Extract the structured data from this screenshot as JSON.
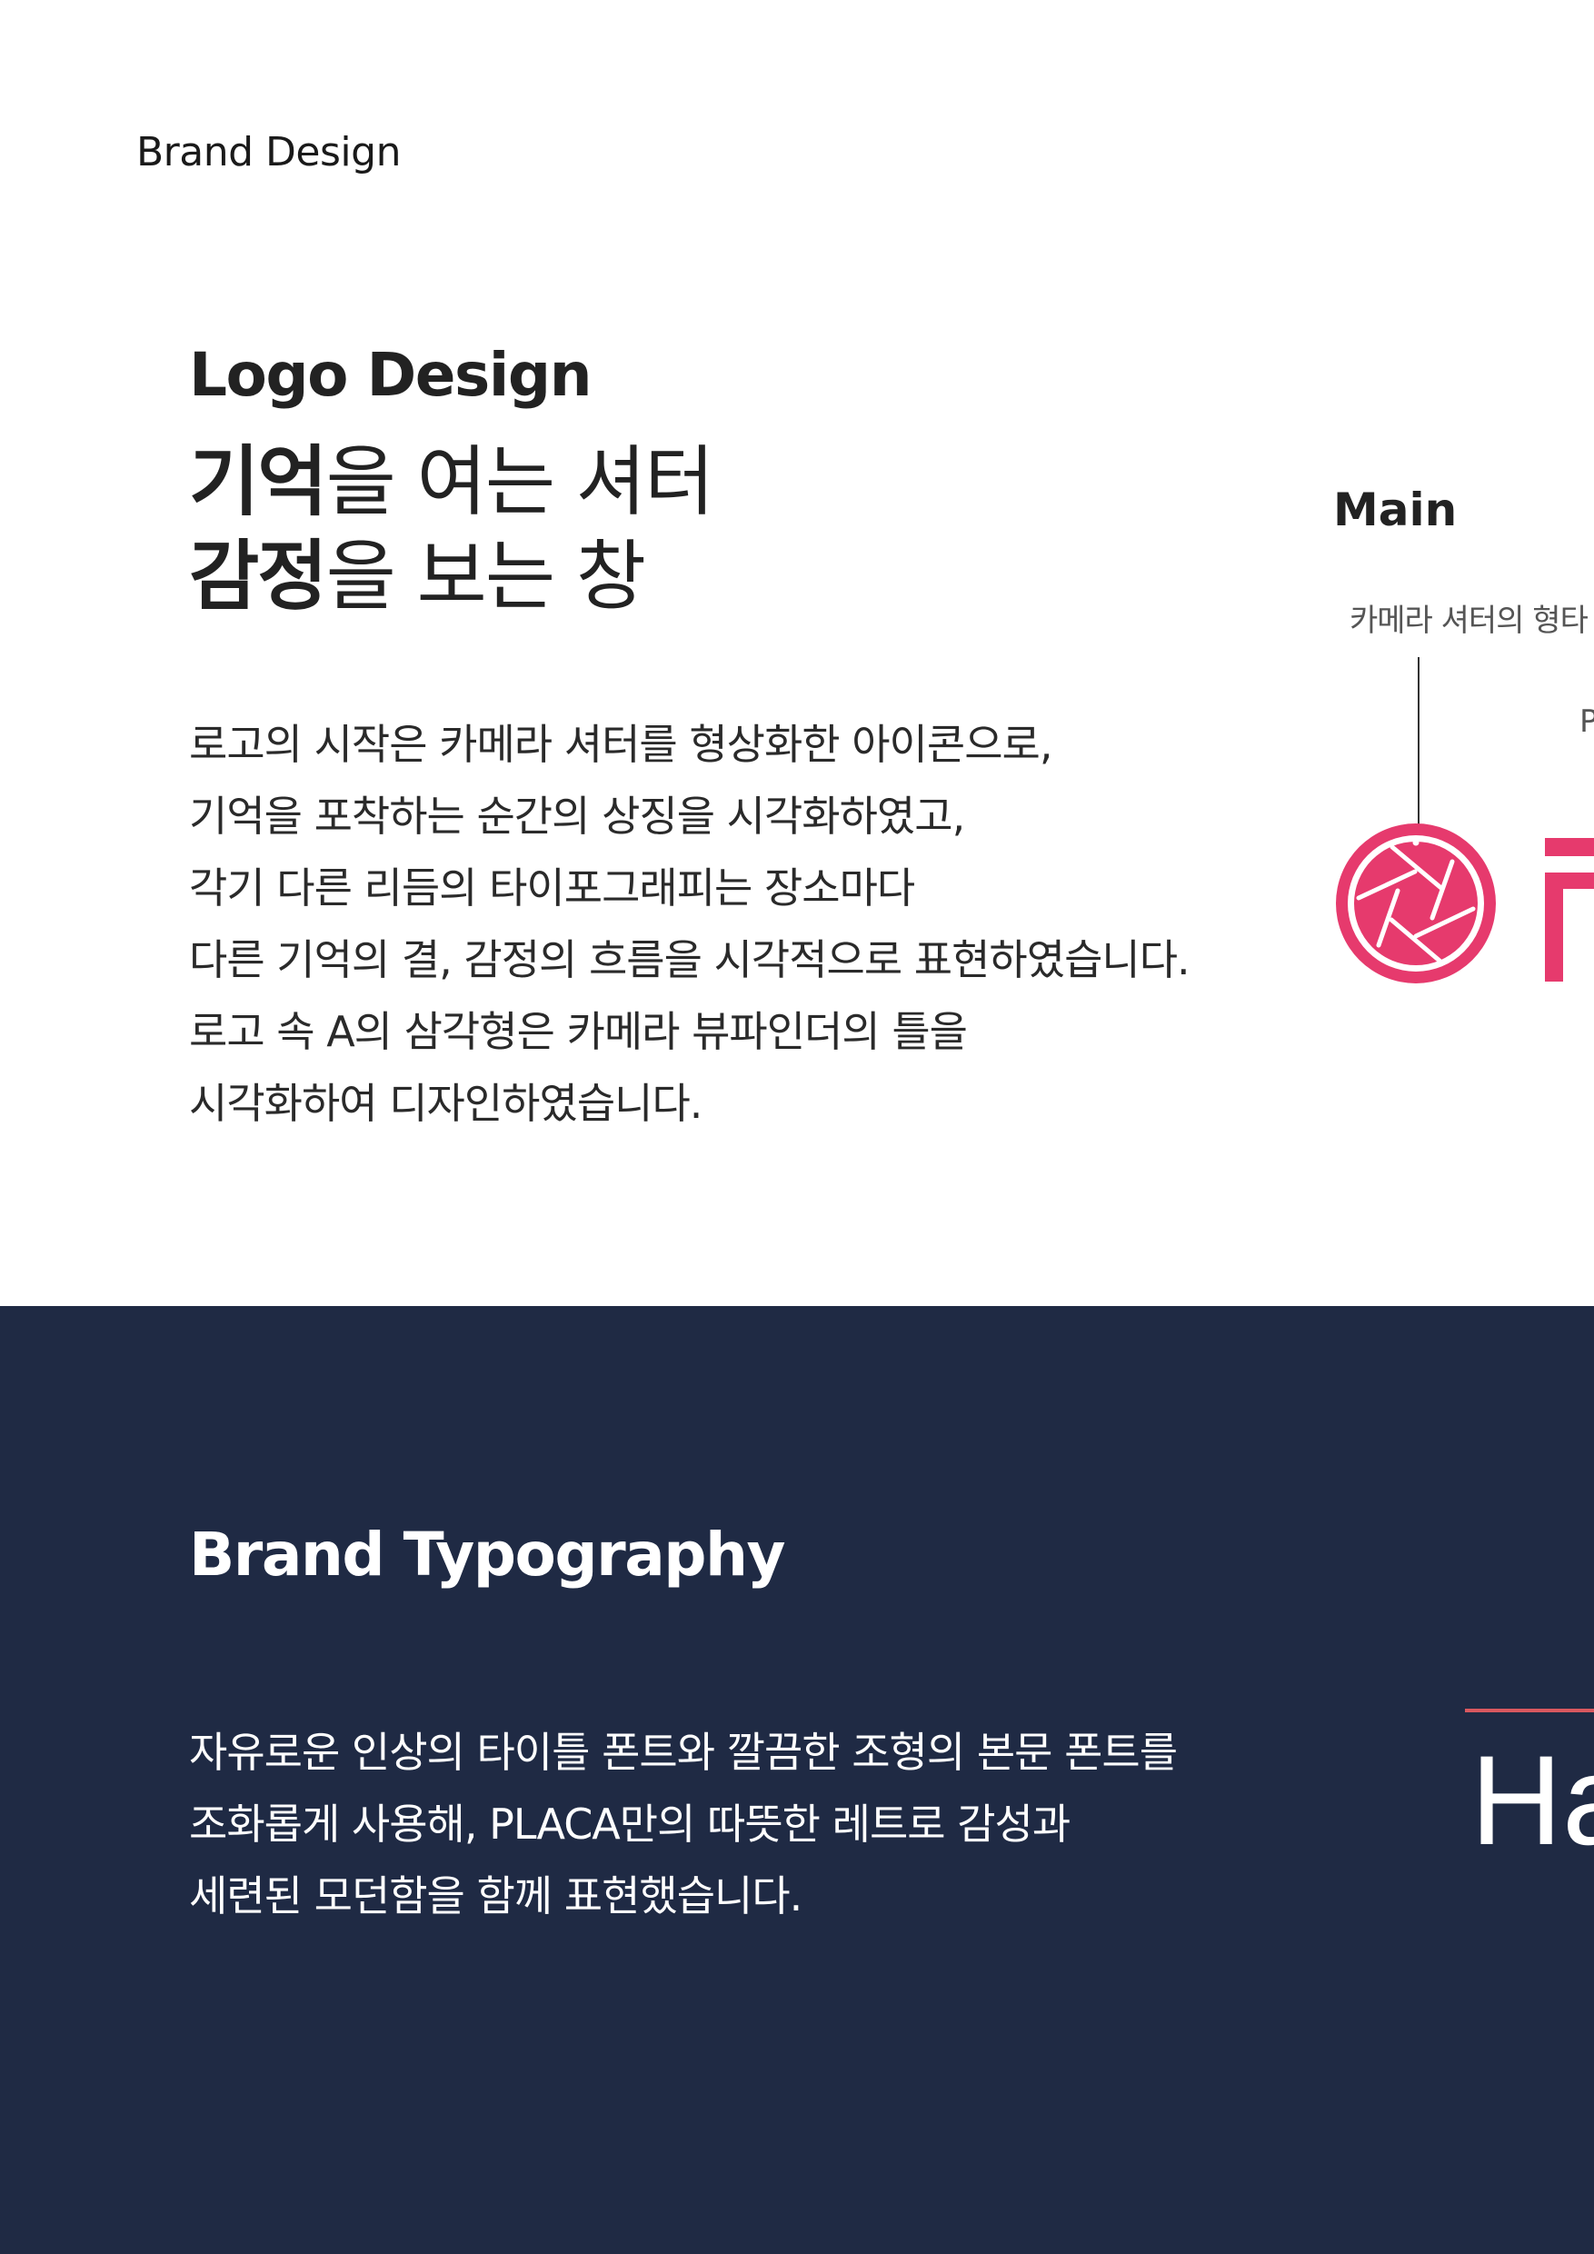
{
  "page": {
    "label": "Brand Design"
  },
  "logo_section": {
    "title": "Logo Design",
    "headline": [
      {
        "bold": "기억",
        "rest": "을 여는 셔터"
      },
      {
        "bold": "감정",
        "rest": "을 보는 창"
      }
    ],
    "body": [
      "로고의 시작은 카메라 셔터를 형상화한 아이콘으로,",
      "기억을 포착하는 순간의 상징을 시각화하였고,",
      "각기 다른 리듬의 타이포그래피는 장소마다",
      "다른 기억의 결, 감정의 흐름을 시각적으로 표현하였습니다.",
      "로고 속 A의 삼각형은 카메라 뷰파인더의 틀을",
      "시각화하여 디자인하였습니다."
    ],
    "main_label": "Main",
    "annotation": "카메라 셔터의 형타",
    "annotation_2": "P",
    "icon": "camera-shutter-icon",
    "brand_color": "#e63a6d"
  },
  "typography_section": {
    "title": "Brand Typography",
    "body": [
      "자유로운 인상의 타이틀 폰트와 깔끔한 조형의 본문 폰트를",
      "조화롭게 사용해, PLACA만의 따뜻한 레트로 감성과",
      "세련된 모던함을 함께 표현했습니다."
    ],
    "specimen_text": "Ha",
    "background_color": "#1f2a44",
    "accent_color": "#d9585f"
  }
}
